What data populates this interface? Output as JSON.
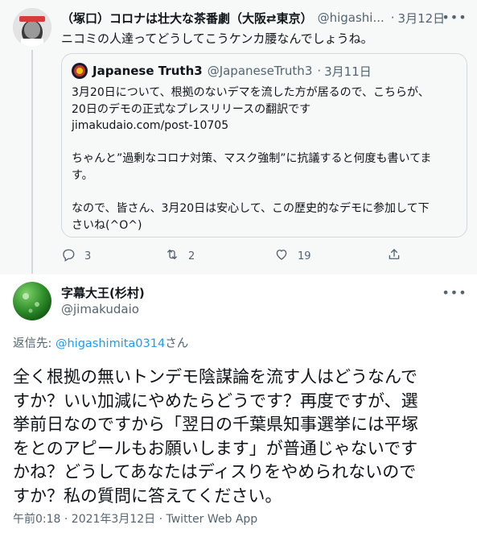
{
  "parent_tweet": {
    "display_name": "（塚口）コロナは壮大な茶番劇（大阪⇄東京）",
    "handle": "@higashi...",
    "separator": "·",
    "date": "3月12日",
    "more_icon": "more-horizontal-icon",
    "text": "ニコミの人達ってどうしてこうケンカ腰なんでしょうね。",
    "quoted_tweet": {
      "display_name": "Japanese Truth3",
      "handle": "@JapaneseTruth3",
      "separator": "·",
      "date": "3月11日",
      "lines": [
        "3月20日について、根拠のないデマを流した方が居るので、こちらが、",
        "20日のデモの正式なプレスリリースの翻訳です",
        "jimakudaio.com/post-10705",
        "",
        "ちゃんと”過剰なコロナ対策、マスク強制”に抗議すると何度も書いてま",
        "す。",
        "",
        "なので、皆さん、3月20日は安心して、この歴史的なデモに参加して下",
        "さいね(^O^)"
      ]
    },
    "actions": {
      "reply_count": "3",
      "retweet_count": "2",
      "like_count": "19",
      "reply_icon": "reply-icon",
      "retweet_icon": "retweet-icon",
      "like_icon": "heart-icon",
      "share_icon": "share-icon"
    }
  },
  "main_tweet": {
    "display_name": "字幕大王(杉村)",
    "handle": "@jimakudaio",
    "reply_prefix": "返信先: ",
    "reply_mention": "@higashimita0314",
    "reply_suffix": "さん",
    "body_lines": [
      "全く根拠の無いトンデモ陰謀論を流す人はどうなんで",
      "すか？いい加減にやめたらどうです？再度ですが、選",
      "挙前日なのですから「翌日の千葉県知事選挙には平塚",
      "をとのアピールもお願いします」が普通じゃないです",
      "かね？どうしてあなたはディスりをやめられないので",
      "すか？私の質問に答えてください。"
    ],
    "meta": "午前0:18 · 2021年3月12日 · Twitter Web App"
  },
  "colors": {
    "link": "#1d9bf0",
    "secondary_text": "#536471",
    "primary_text": "#0f1419",
    "thread_bg": "#f7f9f9",
    "border": "#cfd9de"
  }
}
